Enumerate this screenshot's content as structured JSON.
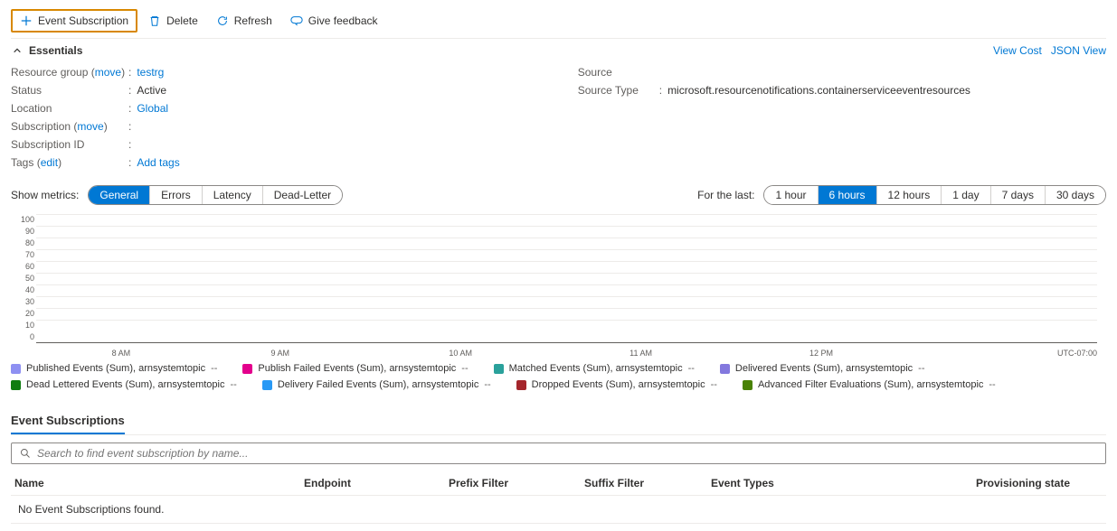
{
  "toolbar": {
    "event_subscription": "Event Subscription",
    "delete": "Delete",
    "refresh": "Refresh",
    "give_feedback": "Give feedback"
  },
  "essentials": {
    "toggle_label": "Essentials",
    "view_cost": "View Cost",
    "json_view": "JSON View",
    "left": {
      "resource_group_label": "Resource group",
      "move1": "move",
      "resource_group_value": "testrg",
      "status_label": "Status",
      "status_value": "Active",
      "location_label": "Location",
      "location_value": "Global",
      "subscription_label": "Subscription",
      "move2": "move",
      "subscription_id_label": "Subscription ID",
      "subscription_id_value": "",
      "tags_label": "Tags",
      "edit": "edit",
      "add_tags": "Add tags"
    },
    "right": {
      "source_label": "Source",
      "source_value": "",
      "source_type_label": "Source Type",
      "source_type_value": "microsoft.resourcenotifications.containerserviceeventresources"
    }
  },
  "metrics": {
    "show_label": "Show metrics:",
    "general": "General",
    "errors": "Errors",
    "latency": "Latency",
    "dead_letter": "Dead-Letter",
    "for_last_label": "For the last:",
    "r1": "1 hour",
    "r2": "6 hours",
    "r3": "12 hours",
    "r4": "1 day",
    "r5": "7 days",
    "r6": "30 days"
  },
  "chart_data": {
    "type": "line",
    "ylim": [
      0,
      100
    ],
    "yticks": [
      "100",
      "90",
      "80",
      "70",
      "60",
      "50",
      "40",
      "30",
      "20",
      "10",
      "0"
    ],
    "xticks": [
      "8 AM",
      "9 AM",
      "10 AM",
      "11 AM",
      "12 PM"
    ],
    "timezone": "UTC-07:00",
    "series": [
      {
        "name": "Published Events (Sum), arnsystemtopic",
        "color": "#8e90f2",
        "value": "--"
      },
      {
        "name": "Publish Failed Events (Sum), arnsystemtopic",
        "color": "#e3008c",
        "value": "--"
      },
      {
        "name": "Matched Events (Sum), arnsystemtopic",
        "color": "#2aa19b",
        "value": "--"
      },
      {
        "name": "Delivered Events (Sum), arnsystemtopic",
        "color": "#8378de",
        "value": "--"
      },
      {
        "name": "Dead Lettered Events (Sum), arnsystemtopic",
        "color": "#107c10",
        "value": "--"
      },
      {
        "name": "Delivery Failed Events (Sum), arnsystemtopic",
        "color": "#2899f5",
        "value": "--"
      },
      {
        "name": "Dropped Events (Sum), arnsystemtopic",
        "color": "#a4262c",
        "value": "--"
      },
      {
        "name": "Advanced Filter Evaluations (Sum), arnsystemtopic",
        "color": "#498205",
        "value": "--"
      }
    ]
  },
  "subscriptions": {
    "title": "Event Subscriptions",
    "search_placeholder": "Search to find event subscription by name...",
    "columns": {
      "name": "Name",
      "endpoint": "Endpoint",
      "prefix": "Prefix Filter",
      "suffix": "Suffix Filter",
      "types": "Event Types",
      "provision": "Provisioning state"
    },
    "empty": "No Event Subscriptions found."
  }
}
